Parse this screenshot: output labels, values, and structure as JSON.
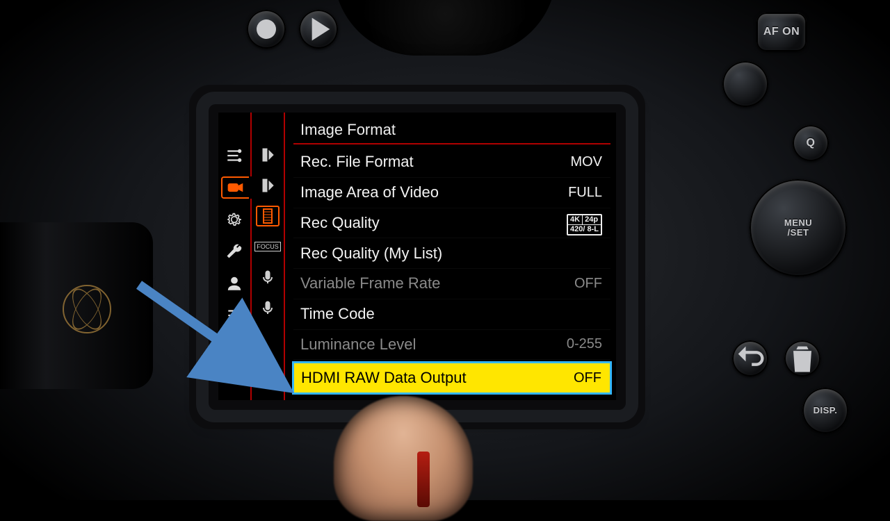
{
  "hardware_buttons": {
    "af_on": "AF ON",
    "q": "Q",
    "menu_set": "MENU\n/SET",
    "disp": "DISP.",
    "trash_icon": "trash-icon",
    "back_icon": "return-icon",
    "rec_icon": "record-icon",
    "play_icon": "play-icon"
  },
  "lcd": {
    "heading": "Image Format",
    "categories": [
      {
        "id": "photo",
        "icon": "sliders-icon"
      },
      {
        "id": "video",
        "icon": "video-camera-icon",
        "active": true
      },
      {
        "id": "setup",
        "icon": "gear-icon"
      },
      {
        "id": "custom",
        "icon": "wrench-icon"
      },
      {
        "id": "playback",
        "icon": "person-icon"
      },
      {
        "id": "my-menu",
        "icon": "list-icon"
      }
    ],
    "subtabs": [
      {
        "id": "sub-image-1",
        "icon": "filmstrip-left-icon"
      },
      {
        "id": "sub-image-2",
        "icon": "filmstrip-left-icon"
      },
      {
        "id": "sub-film",
        "icon": "filmstrip-icon",
        "active": true
      },
      {
        "id": "sub-focus",
        "label": "FOCUS"
      },
      {
        "id": "sub-mic-1",
        "icon": "mic-icon"
      },
      {
        "id": "sub-mic-2",
        "icon": "mic-icon"
      }
    ],
    "items": [
      {
        "label": "Rec. File Format",
        "value": "MOV"
      },
      {
        "label": "Image Area of Video",
        "value": "FULL"
      },
      {
        "label": "Rec Quality",
        "value_badge": {
          "top_left": "4K",
          "top_right": "24p",
          "bottom": "420/ 8-L"
        }
      },
      {
        "label": "Rec Quality (My List)",
        "value": ""
      },
      {
        "label": "Variable Frame Rate",
        "value": "OFF",
        "disabled": true
      },
      {
        "label": "Time Code",
        "value": ""
      },
      {
        "label": "Luminance Level",
        "value": "0-255",
        "disabled": true
      },
      {
        "label": "HDMI RAW Data Output",
        "value": "OFF",
        "selected": true
      }
    ]
  },
  "annotation": {
    "arrow_color": "#4a84c4"
  }
}
